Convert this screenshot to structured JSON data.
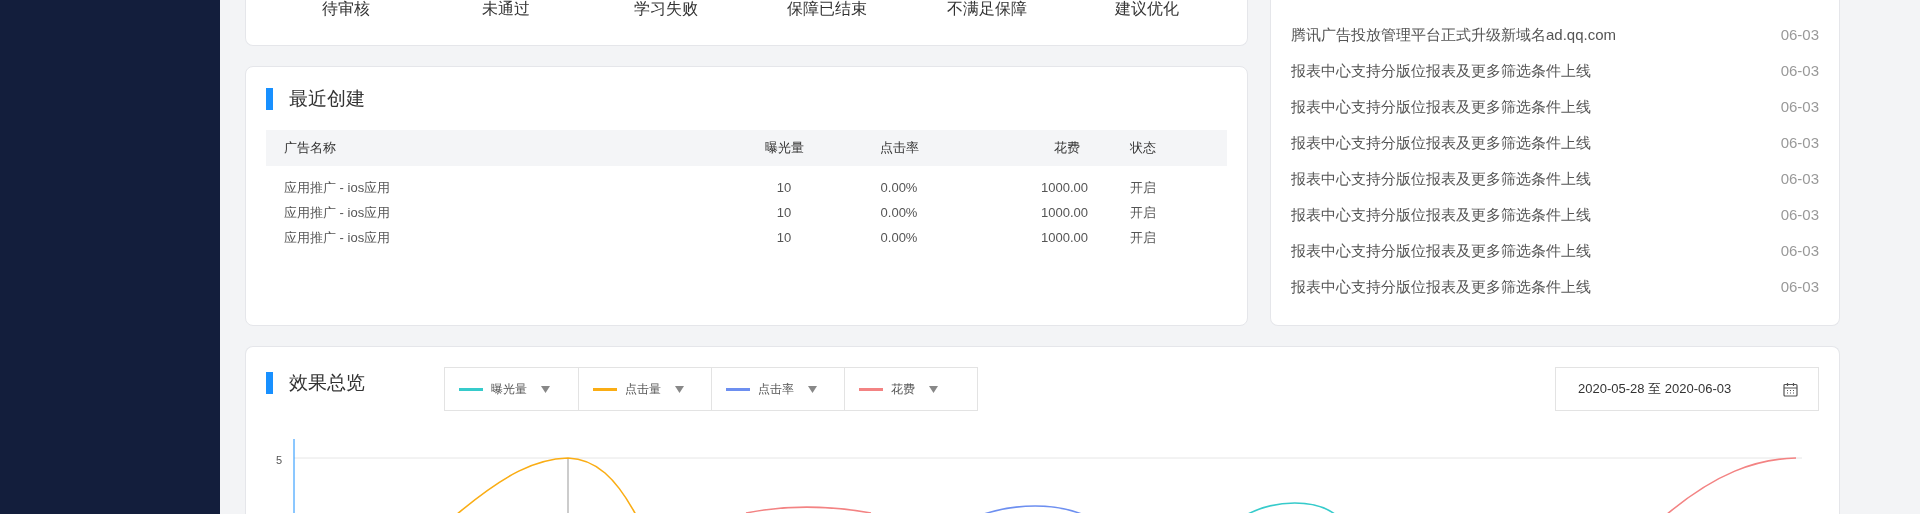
{
  "status_labels": [
    "待审核",
    "未通过",
    "学习失败",
    "保障已结束",
    "不满足保障",
    "建议优化"
  ],
  "recent": {
    "title": "最近创建",
    "columns": [
      "广告名称",
      "曝光量",
      "点击率",
      "花费",
      "状态"
    ],
    "rows": [
      {
        "name": "应用推广 - ios应用",
        "impressions": "10",
        "ctr": "0.00%",
        "cost": "1000.00",
        "status": "开启"
      },
      {
        "name": "应用推广 - ios应用",
        "impressions": "10",
        "ctr": "0.00%",
        "cost": "1000.00",
        "status": "开启"
      },
      {
        "name": "应用推广 - ios应用",
        "impressions": "10",
        "ctr": "0.00%",
        "cost": "1000.00",
        "status": "开启"
      }
    ]
  },
  "news": [
    {
      "title": "腾讯广告投放管理平台正式升级新域名ad.qq.com",
      "date": "06-03"
    },
    {
      "title": "报表中心支持分版位报表及更多筛选条件上线",
      "date": "06-03"
    },
    {
      "title": "报表中心支持分版位报表及更多筛选条件上线",
      "date": "06-03"
    },
    {
      "title": "报表中心支持分版位报表及更多筛选条件上线",
      "date": "06-03"
    },
    {
      "title": "报表中心支持分版位报表及更多筛选条件上线",
      "date": "06-03"
    },
    {
      "title": "报表中心支持分版位报表及更多筛选条件上线",
      "date": "06-03"
    },
    {
      "title": "报表中心支持分版位报表及更多筛选条件上线",
      "date": "06-03"
    },
    {
      "title": "报表中心支持分版位报表及更多筛选条件上线",
      "date": "06-03"
    }
  ],
  "overview": {
    "title": "效果总览",
    "legend": [
      {
        "label": "曝光量",
        "color": "#36cbcb"
      },
      {
        "label": "点击量",
        "color": "#faad14"
      },
      {
        "label": "点击率",
        "color": "#6d8ff0"
      },
      {
        "label": "花费",
        "color": "#f38383"
      }
    ],
    "date_range": "2020-05-28 至 2020-06-03",
    "y_tick": "5"
  }
}
